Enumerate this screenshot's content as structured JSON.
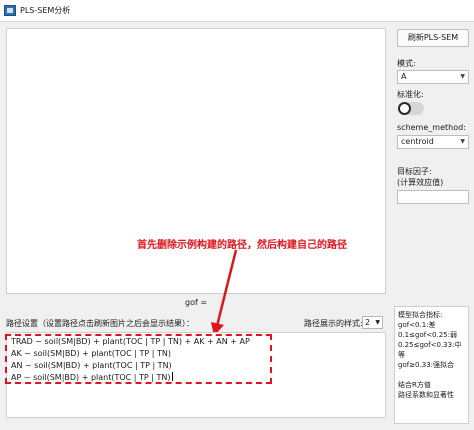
{
  "window": {
    "title": "PLS-SEM分析"
  },
  "gof_label": "gof =",
  "path_settings": {
    "label": "路径设置（设置路径点击刷新图片之后会显示结果）：",
    "style_label": "路径展示的样式:",
    "style_value": "2",
    "lines": [
      "TRAD ~ soil(SM|BD) + plant(TOC | TP | TN) + AK + AN + AP",
      "AK ~ soil(SM|BD) + plant(TOC | TP | TN)",
      "AN ~ soil(SM|BD) + plant(TOC | TP | TN)",
      "AP ~ soil(SM|BD) + plant(TOC | TP | TN)"
    ]
  },
  "annotation": {
    "text": "首先删除示例构建的路径，然后构建自己的路径",
    "color": "#e0141e"
  },
  "right_panel": {
    "refresh_button": "刷新PLS-SEM",
    "mode_label": "模式:",
    "mode_value": "A",
    "standardize_label": "标准化:",
    "standardize_on": false,
    "scheme_label": "scheme_method:",
    "scheme_value": "centroid",
    "target_label_1": "目标因子:",
    "target_label_2": "(计算效应值)",
    "target_value": "",
    "info_lines": [
      "模型拟合指标:",
      "gof<0.1:差",
      "0.1≤gof<0.25:弱",
      "0.25≤gof<0.33:中等",
      "gof≥0.33:强拟合"
    ],
    "info_lines_2": [
      "结合R方值",
      "路径系数和显著性"
    ]
  }
}
